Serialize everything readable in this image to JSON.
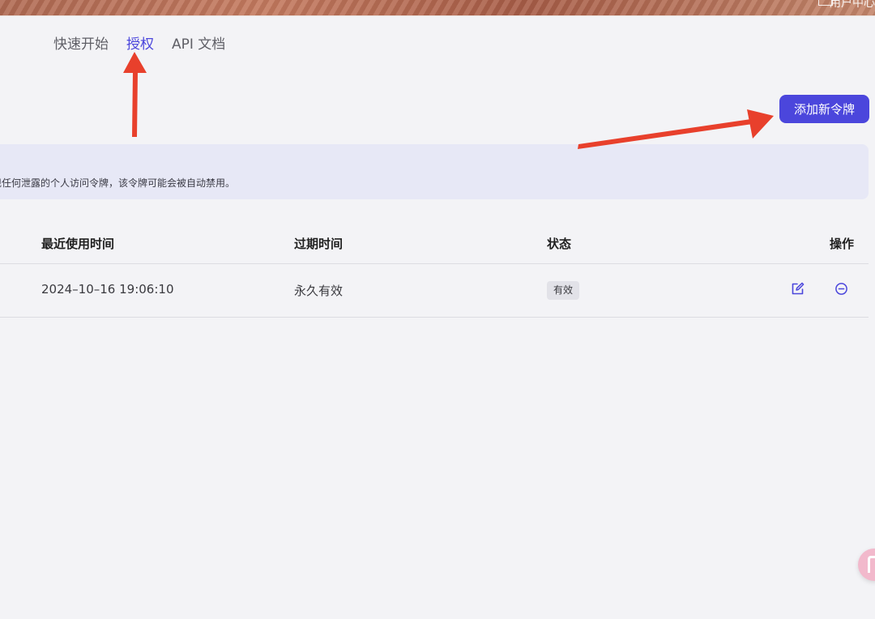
{
  "header": {
    "username": "用户中心"
  },
  "tabs": [
    {
      "label": "快速开始",
      "active": false
    },
    {
      "label": "授权",
      "active": true
    },
    {
      "label": "API 文档",
      "active": false
    }
  ],
  "add_token_button": {
    "label": "添加新令牌"
  },
  "notice": {
    "text": "现任何泄露的个人访问令牌，该令牌可能会被自动禁用。"
  },
  "table": {
    "columns": {
      "last_used": "最近使用时间",
      "expire": "过期时间",
      "status": "状态",
      "actions": "操作"
    },
    "rows": [
      {
        "last_used": "2024–10–16 19:06:10",
        "expire": "永久有效",
        "status": "有效"
      }
    ]
  },
  "icons": {
    "edit": "edit-icon",
    "remove": "minus-circle-icon",
    "user": "user-icon"
  },
  "colors": {
    "accent": "#4b46dc",
    "annotation": "#e8402c",
    "notice_bg": "#e7e8f6",
    "helper": "#f2b9cc"
  }
}
